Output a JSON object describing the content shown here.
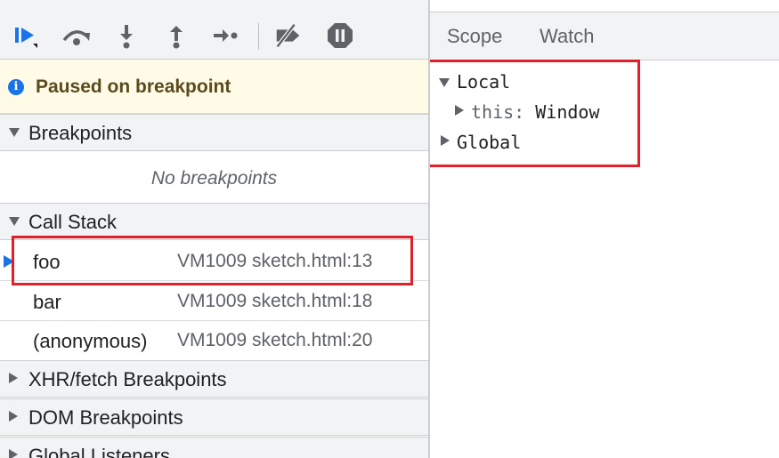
{
  "toolbar": {
    "buttons": [
      {
        "name": "resume-button",
        "icon": "resume-icon"
      },
      {
        "name": "step-over-button",
        "icon": "step-over-icon"
      },
      {
        "name": "step-into-button",
        "icon": "step-into-icon"
      },
      {
        "name": "step-out-button",
        "icon": "step-out-icon"
      },
      {
        "name": "step-button",
        "icon": "step-icon"
      },
      {
        "name": "deactivate-breakpoints-button",
        "icon": "deactivate-breakpoints-icon"
      },
      {
        "name": "pause-on-exceptions-button",
        "icon": "pause-icon"
      }
    ],
    "accent": "#1a73e8"
  },
  "banner": {
    "text": "Paused on breakpoint",
    "icon": "info-icon"
  },
  "breakpoints": {
    "label": "Breakpoints",
    "empty": "No breakpoints"
  },
  "call_stack": {
    "label": "Call Stack",
    "frames": [
      {
        "fn": "foo",
        "location": "VM1009 sketch.html:13"
      },
      {
        "fn": "bar",
        "location": "VM1009 sketch.html:18"
      },
      {
        "fn": "(anonymous)",
        "location": "VM1009 sketch.html:20"
      }
    ]
  },
  "sections": {
    "xhr": "XHR/fetch Breakpoints",
    "dom": "DOM Breakpoints",
    "global": "Global Listeners"
  },
  "scope_panel": {
    "tabs": [
      "Scope",
      "Watch"
    ],
    "local_label": "Local",
    "this_key": "this:",
    "this_value": "Window",
    "global_label": "Global"
  },
  "highlight_color": "#e0202a"
}
